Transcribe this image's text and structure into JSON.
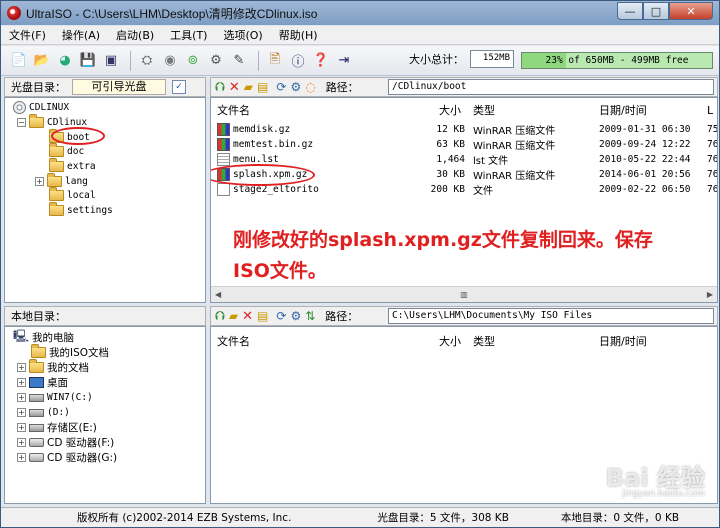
{
  "window": {
    "title": "UltraISO - C:\\Users\\LHM\\Desktop\\清明修改CDlinux.iso",
    "min": "—",
    "max": "□",
    "close": "✕"
  },
  "menu": [
    "文件(F)",
    "操作(A)",
    "启动(B)",
    "工具(T)",
    "选项(O)",
    "帮助(H)"
  ],
  "toolbar": {
    "total_label": "大小总计：",
    "total_value": "152MB",
    "capacity_text": "23% of 650MB - 499MB free",
    "capacity_percent": 23
  },
  "cd_pane": {
    "label": "光盘目录：",
    "boot_type": "可引导光盘",
    "path_label": "路径：",
    "path": "/CDlinux/boot",
    "tree": {
      "root": "CDLINUX",
      "folder": "CDlinux",
      "children": [
        "boot",
        "doc",
        "extra",
        "lang",
        "local",
        "settings"
      ]
    },
    "columns": {
      "name": "文件名",
      "size": "大小",
      "type": "类型",
      "date": "日期/时间",
      "extra": "L"
    },
    "files": [
      {
        "name": "memdisk.gz",
        "size": "12 KB",
        "type": "WinRAR 压缩文件",
        "date": "2009-01-31 06:30",
        "l": "75",
        "icon": "rar"
      },
      {
        "name": "memtest.bin.gz",
        "size": "63 KB",
        "type": "WinRAR 压缩文件",
        "date": "2009-09-24 12:22",
        "l": "76",
        "icon": "rar"
      },
      {
        "name": "menu.lst",
        "size": "1,464",
        "type": "lst 文件",
        "date": "2010-05-22 22:44",
        "l": "76",
        "icon": "doc"
      },
      {
        "name": "splash.xpm.gz",
        "size": "30 KB",
        "type": "WinRAR 压缩文件",
        "date": "2014-06-01 20:56",
        "l": "76",
        "icon": "rar"
      },
      {
        "name": "stage2_eltorito",
        "size": "200 KB",
        "type": "文件",
        "date": "2009-02-22 06:50",
        "l": "76",
        "icon": "plain"
      }
    ]
  },
  "annotation": "刚修改好的splash.xpm.gz文件复制回来。保存ISO文件。",
  "local_pane": {
    "label": "本地目录：",
    "path_label": "路径：",
    "path": "C:\\Users\\LHM\\Documents\\My ISO Files",
    "tree": [
      {
        "label": "我的电脑",
        "icon": "computer"
      },
      {
        "label": "我的ISO文档",
        "icon": "folder"
      },
      {
        "label": "我的文档",
        "icon": "folder"
      },
      {
        "label": "桌面",
        "icon": "desktop"
      },
      {
        "label": "WIN7(C:)",
        "icon": "drive"
      },
      {
        "label": "(D:)",
        "icon": "drive"
      },
      {
        "label": "存储区(E:)",
        "icon": "drive"
      },
      {
        "label": "CD 驱动器(F:)",
        "icon": "cd"
      },
      {
        "label": "CD 驱动器(G:)",
        "icon": "cd"
      }
    ],
    "columns": {
      "name": "文件名",
      "size": "大小",
      "type": "类型",
      "date": "日期/时间"
    }
  },
  "status": {
    "copyright": "版权所有 (c)2002-2014 EZB Systems, Inc.",
    "cd_summary": "光盘目录：5 文件，308 KB",
    "local_summary": "本地目录：0 文件，0 KB"
  },
  "watermark": {
    "text": "Bai 经验",
    "sub": "jingyan.baidu.com"
  },
  "colors": {
    "annotation": "#e02020",
    "capacity_fill": "#8fd880",
    "capacity_bg": "#b9e8b0"
  }
}
